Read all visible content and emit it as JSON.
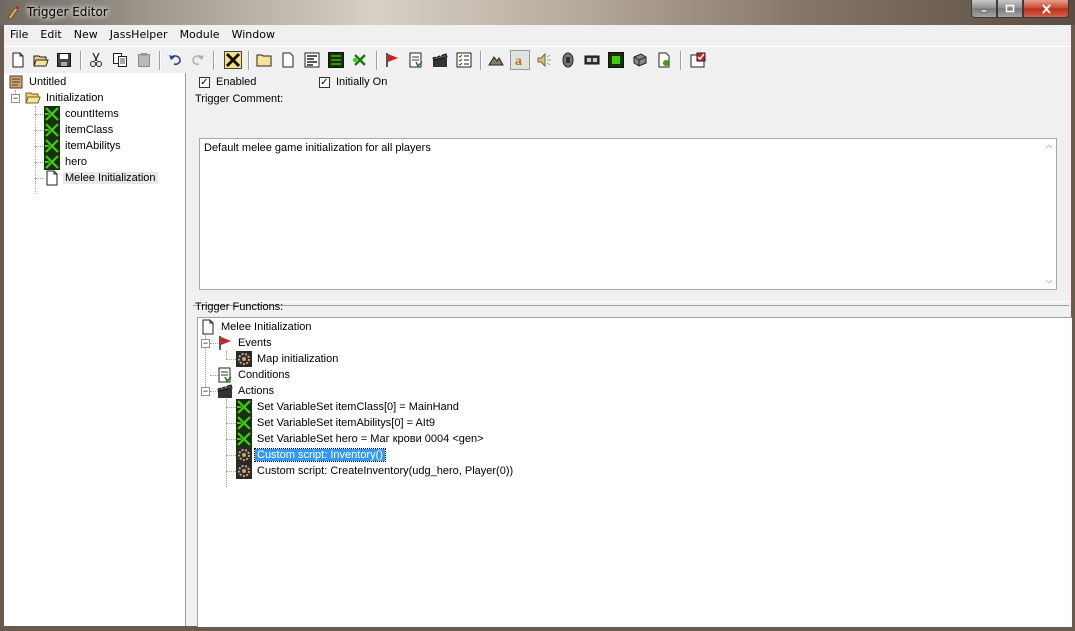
{
  "window": {
    "title": "Trigger Editor"
  },
  "menubar": {
    "items": [
      "File",
      "Edit",
      "New",
      "JassHelper",
      "Module",
      "Window"
    ]
  },
  "toolbar": {
    "icons": [
      "new-icon",
      "open-icon",
      "save-icon",
      "cut-icon",
      "copy-icon",
      "paste-icon",
      "undo-icon",
      "redo-icon",
      "jass-icon",
      "new-category-icon",
      "new-trigger-icon",
      "new-comment-icon",
      "new-variable-icon",
      "new-event-icon",
      "new-condition-icon",
      "new-action-icon",
      "test-map-icon",
      "terrain-icon",
      "object-icon",
      "sound-icon",
      "ai-icon",
      "import-icon",
      "object-editor-icon",
      "campaign-icon",
      "map-icon"
    ]
  },
  "tree": {
    "root": "Untitled",
    "category": "Initialization",
    "items": [
      {
        "label": "countItems",
        "icon": "variable-trigger-icon"
      },
      {
        "label": "itemClass",
        "icon": "variable-trigger-icon"
      },
      {
        "label": "itemAbilitys",
        "icon": "variable-trigger-icon"
      },
      {
        "label": "hero",
        "icon": "variable-trigger-icon"
      },
      {
        "label": "Melee Initialization",
        "icon": "trigger-doc-icon"
      }
    ]
  },
  "trigger": {
    "enabled_label": "Enabled",
    "enabled": true,
    "initially_on_label": "Initially On",
    "initially_on": true,
    "comment_label": "Trigger Comment:",
    "comment": "Default melee game initialization for all players",
    "functions_label": "Trigger Functions:"
  },
  "functions": {
    "name": "Melee Initialization",
    "events_label": "Events",
    "events": [
      "Map initialization"
    ],
    "conditions_label": "Conditions",
    "actions_label": "Actions",
    "actions": [
      "Set VariableSet itemClass[0] = MainHand",
      "Set VariableSet itemAbilitys[0] = AIt9",
      "Set VariableSet hero = Маг крови 0004 <gen>",
      "Custom script:   Inventory()",
      "Custom script:   CreateInventory(udg_hero, Player(0))"
    ],
    "selected_action_index": 3
  },
  "colors": {
    "selection": "#3399ff",
    "variable_icon_bg": "#1a2e10",
    "variable_icon_fg": "#3fd000"
  }
}
